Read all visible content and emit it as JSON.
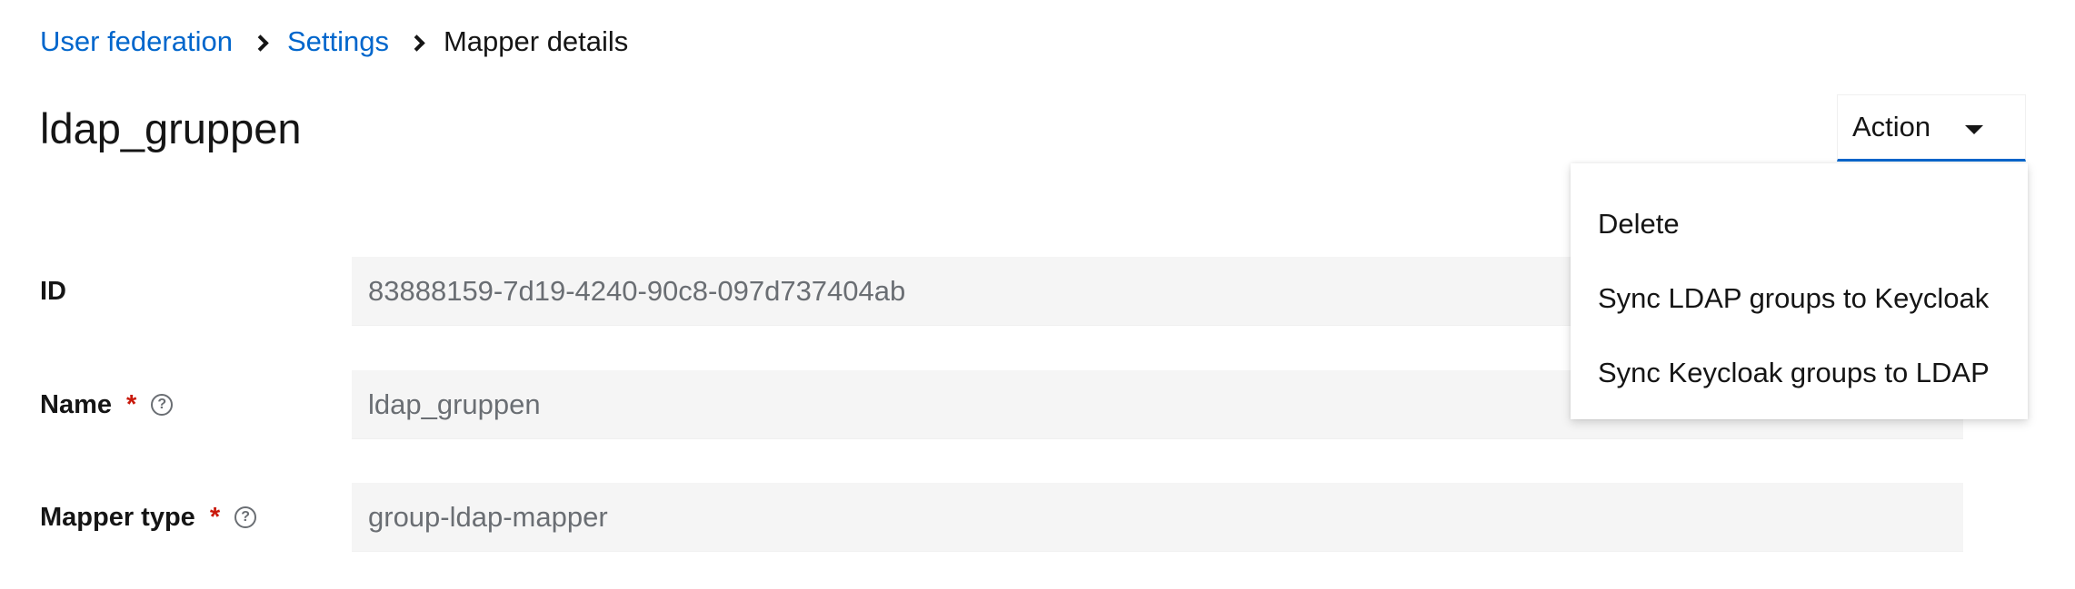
{
  "breadcrumb": {
    "items": [
      "User federation",
      "Settings"
    ],
    "current": "Mapper details"
  },
  "page_title": "ldap_gruppen",
  "action": {
    "label": "Action",
    "menu_items": [
      "Delete",
      "Sync LDAP groups to Keycloak",
      "Sync Keycloak groups to LDAP"
    ]
  },
  "form": {
    "id": {
      "label": "ID",
      "value": "83888159-7d19-4240-90c8-097d737404ab"
    },
    "name": {
      "label": "Name",
      "required": "*",
      "value": "ldap_gruppen"
    },
    "mapper_type": {
      "label": "Mapper type",
      "required": "*",
      "value": "group-ldap-mapper"
    }
  },
  "icons": {
    "help": "help-circle-icon",
    "breadcrumb_separator": "chevron-right-icon",
    "dropdown_caret": "caret-down-icon"
  },
  "colors": {
    "link": "#0066cc",
    "required": "#c9190b",
    "input_bg": "#f5f5f5",
    "text": "#151515",
    "muted": "#6a6e73"
  }
}
